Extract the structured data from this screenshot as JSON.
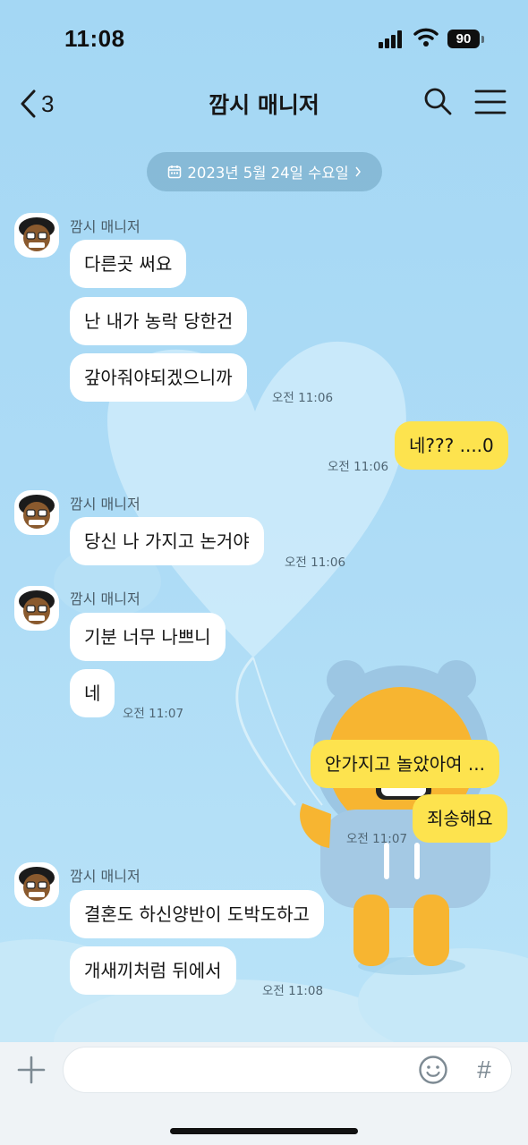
{
  "status_bar": {
    "time": "11:08",
    "battery": "90"
  },
  "header": {
    "back_count": "3",
    "title": "깜시 매니저"
  },
  "date_divider": {
    "label": "2023년 5월 24일 수요일"
  },
  "messages": [
    {
      "sender": "깜시 매니저",
      "bubbles": [
        "다른곳 써요",
        "난 내가 농락 당한건",
        "갚아줘야되겠으니까"
      ],
      "time": "오전 11:06"
    },
    {
      "mine": true,
      "bubbles": [
        "네??? ....0"
      ],
      "time": "오전 11:06"
    },
    {
      "sender": "깜시 매니저",
      "bubbles": [
        "당신 나 가지고 논거야"
      ],
      "time": "오전 11:06"
    },
    {
      "sender": "깜시 매니저",
      "bubbles": [
        "기분 너무 나쁘니",
        "네"
      ],
      "time": "오전 11:07"
    },
    {
      "mine": true,
      "bubbles": [
        "안가지고 놀았아여 ...",
        "죄송해요"
      ],
      "time": "오전 11:07"
    },
    {
      "sender": "깜시 매니저",
      "bubbles": [
        "결혼도 하신양반이 도박도하고",
        "개새끼처럼 뒤에서"
      ],
      "time": "오전 11:08"
    }
  ],
  "input_bar": {
    "placeholder": ""
  },
  "icons": {
    "back": "chevron-left-icon",
    "search": "search-icon",
    "menu": "hamburger-icon",
    "calendar": "calendar-icon",
    "plus": "plus-icon",
    "emoji": "smiley-icon",
    "hash": "#"
  },
  "colors": {
    "background": "#a9d9f4",
    "my_bubble": "#fde34e",
    "their_bubble": "#ffffff"
  }
}
